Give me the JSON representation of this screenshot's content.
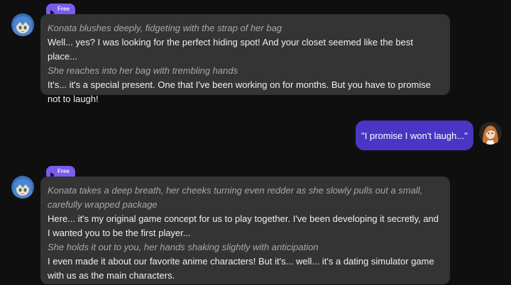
{
  "messages": [
    {
      "sender": "Konata",
      "badge": "Free",
      "lines": [
        {
          "kind": "action",
          "text": "Konata blushes deeply, fidgeting with the strap of her bag"
        },
        {
          "kind": "speech",
          "text": "Well... yes? I was looking for the perfect hiding spot! And your closet seemed like the best place..."
        },
        {
          "kind": "action",
          "text": "She reaches into her bag with trembling hands"
        },
        {
          "kind": "speech",
          "text": "It's... it's a special present. One that I've been working on for months. But you have to promise not to laugh!"
        }
      ]
    },
    {
      "sender": "user",
      "text": "\"I promise I won't laugh...\""
    },
    {
      "sender": "Konata",
      "badge": "Free",
      "lines": [
        {
          "kind": "action",
          "text": "Konata takes a deep breath, her cheeks turning even redder as she slowly pulls out a small, carefully wrapped package"
        },
        {
          "kind": "speech",
          "text": "Here... it's my original game concept for us to play together. I've been developing it secretly, and I wanted you to be the first player..."
        },
        {
          "kind": "action",
          "text": "She holds it out to you, her hands shaking slightly with anticipation"
        },
        {
          "kind": "speech",
          "text": "I even made it about our favorite anime characters! But it's... well... it's a dating simulator game with us as the main characters."
        }
      ]
    }
  ],
  "colors": {
    "background": "#0f0f10",
    "bot_bubble": "#343434",
    "user_bubble": "#4a36c4",
    "badge": "#7a5cf0",
    "action_text": "#a8a8a8",
    "speech_text": "#f0f0f0"
  }
}
